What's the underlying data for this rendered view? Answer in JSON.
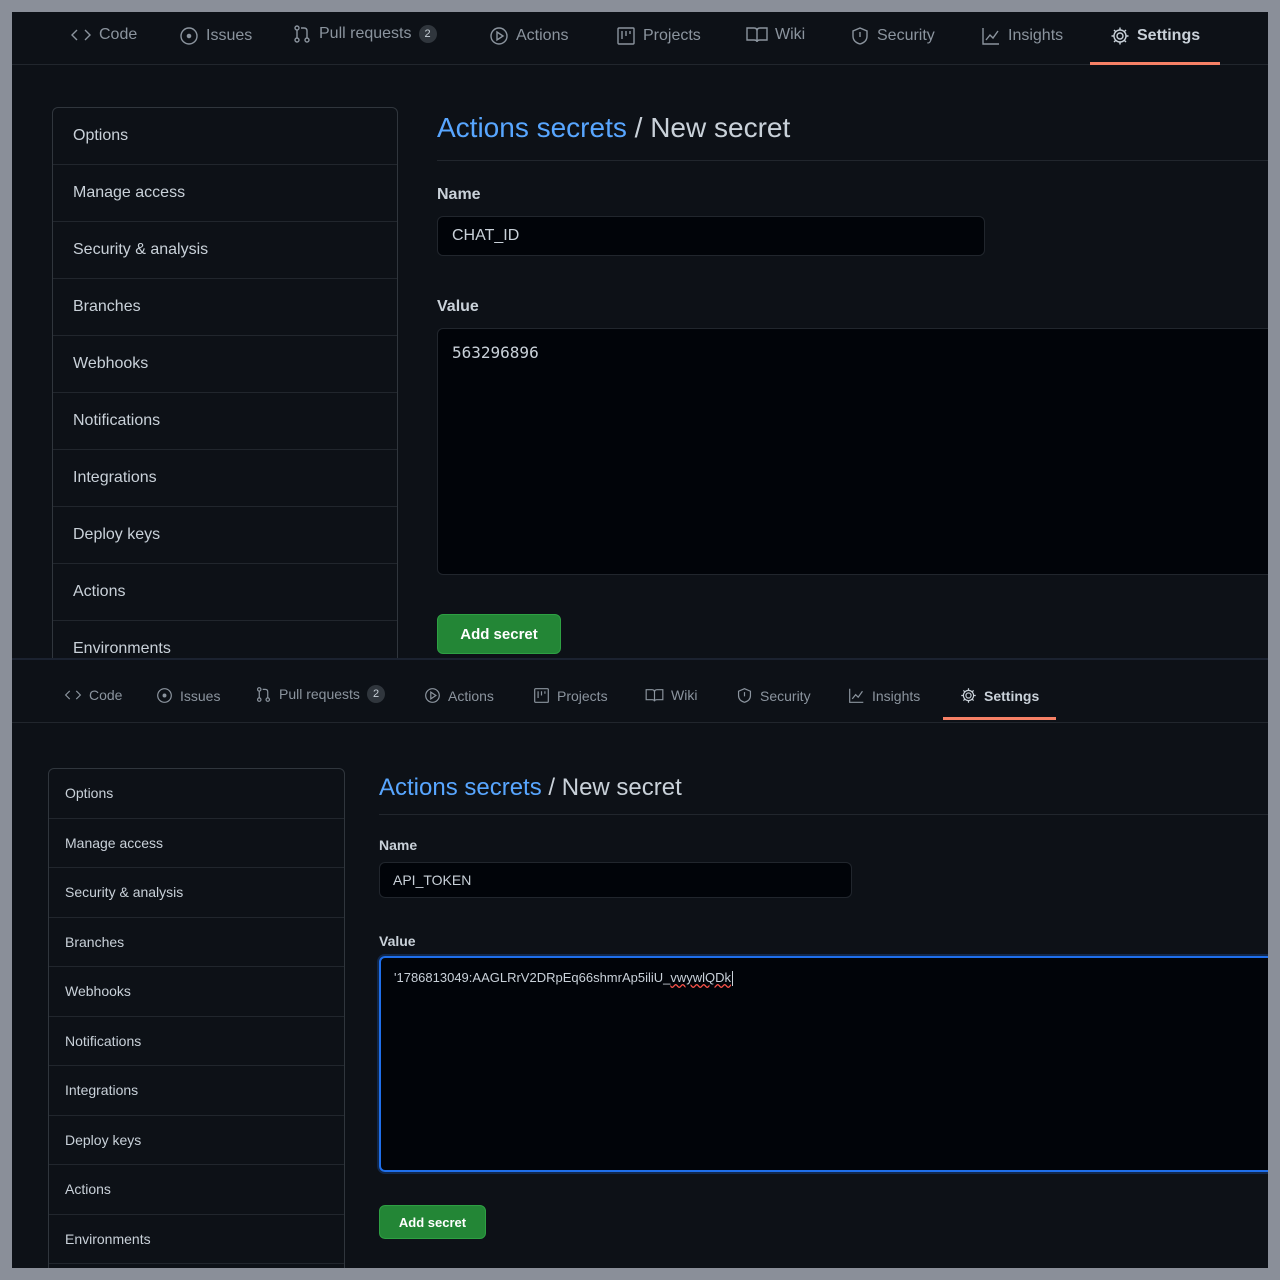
{
  "screenshots": [
    {
      "tabs": [
        {
          "label": "Code",
          "icon": "code-icon"
        },
        {
          "label": "Issues",
          "icon": "issue-icon"
        },
        {
          "label": "Pull requests",
          "icon": "pull-request-icon",
          "count": "2"
        },
        {
          "label": "Actions",
          "icon": "play-icon"
        },
        {
          "label": "Projects",
          "icon": "project-icon"
        },
        {
          "label": "Wiki",
          "icon": "book-icon"
        },
        {
          "label": "Security",
          "icon": "shield-icon"
        },
        {
          "label": "Insights",
          "icon": "graph-icon"
        },
        {
          "label": "Settings",
          "icon": "gear-icon",
          "selected": true
        }
      ],
      "sidebar": [
        "Options",
        "Manage access",
        "Security & analysis",
        "Branches",
        "Webhooks",
        "Notifications",
        "Integrations",
        "Deploy keys",
        "Actions",
        "Environments"
      ],
      "heading": {
        "link": "Actions secrets",
        "separator": "/",
        "current": "New secret"
      },
      "name_label": "Name",
      "name_value": "CHAT_ID",
      "value_label": "Value",
      "value_value": "563296896",
      "button_label": "Add secret"
    },
    {
      "tabs": [
        {
          "label": "Code",
          "icon": "code-icon"
        },
        {
          "label": "Issues",
          "icon": "issue-icon"
        },
        {
          "label": "Pull requests",
          "icon": "pull-request-icon",
          "count": "2"
        },
        {
          "label": "Actions",
          "icon": "play-icon"
        },
        {
          "label": "Projects",
          "icon": "project-icon"
        },
        {
          "label": "Wiki",
          "icon": "book-icon"
        },
        {
          "label": "Security",
          "icon": "shield-icon"
        },
        {
          "label": "Insights",
          "icon": "graph-icon"
        },
        {
          "label": "Settings",
          "icon": "gear-icon",
          "selected": true
        }
      ],
      "sidebar": [
        "Options",
        "Manage access",
        "Security & analysis",
        "Branches",
        "Webhooks",
        "Notifications",
        "Integrations",
        "Deploy keys",
        "Actions",
        "Environments"
      ],
      "heading": {
        "link": "Actions secrets",
        "separator": "/",
        "current": "New secret"
      },
      "name_label": "Name",
      "name_value": "API_TOKEN",
      "value_label": "Value",
      "value_value_main": "'1786813049:AAGLRrV2DRpEq66shmrAp5iliU_",
      "value_value_flagged": "vwywlQDk",
      "button_label": "Add secret"
    }
  ],
  "colors": {
    "background": "#0d1117",
    "link": "#58a6ff",
    "tab_underline": "#f78166",
    "button": "#238636",
    "focus_border": "#1f6feb"
  }
}
